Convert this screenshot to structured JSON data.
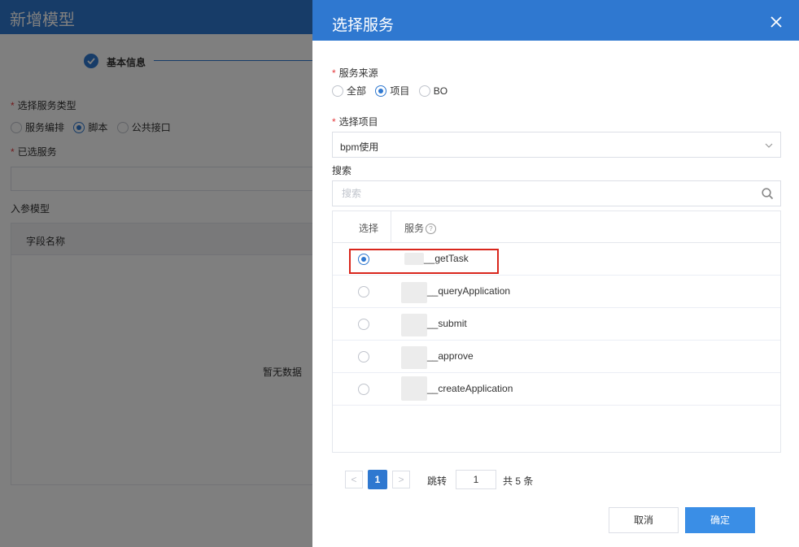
{
  "background": {
    "title": "新增模型",
    "step_label": "基本信息",
    "service_type_label": "选择服务类型",
    "service_type_options": [
      "服务编排",
      "脚本",
      "公共接口"
    ],
    "selected_service_label": "已选服务",
    "params_model_label": "入参模型",
    "table_header_field": "字段名称",
    "empty_text": "暂无数据"
  },
  "drawer": {
    "title": "选择服务",
    "source_label": "服务来源",
    "source_options": [
      "全部",
      "项目",
      "BO"
    ],
    "source_selected": "项目",
    "project_label": "选择项目",
    "project_value": "bpm使用",
    "search_label": "搜索",
    "search_placeholder": "搜索",
    "table": {
      "col_select": "选择",
      "col_service": "服务",
      "help": "?",
      "rows": [
        {
          "name": "__getTask",
          "selected": true
        },
        {
          "name": "__queryApplication",
          "selected": false
        },
        {
          "name": "__submit",
          "selected": false
        },
        {
          "name": "__approve",
          "selected": false
        },
        {
          "name": "__createApplication",
          "selected": false
        }
      ]
    },
    "pagination": {
      "prev": "<",
      "current_page": "1",
      "next": ">",
      "jump_label": "跳转",
      "jump_value": "1",
      "total_text": "共 5 条"
    },
    "cancel_label": "取消",
    "confirm_label": "确定"
  },
  "colors": {
    "primary": "#2f78d0",
    "required": "#e4393c",
    "highlight_border": "#d9261c"
  }
}
